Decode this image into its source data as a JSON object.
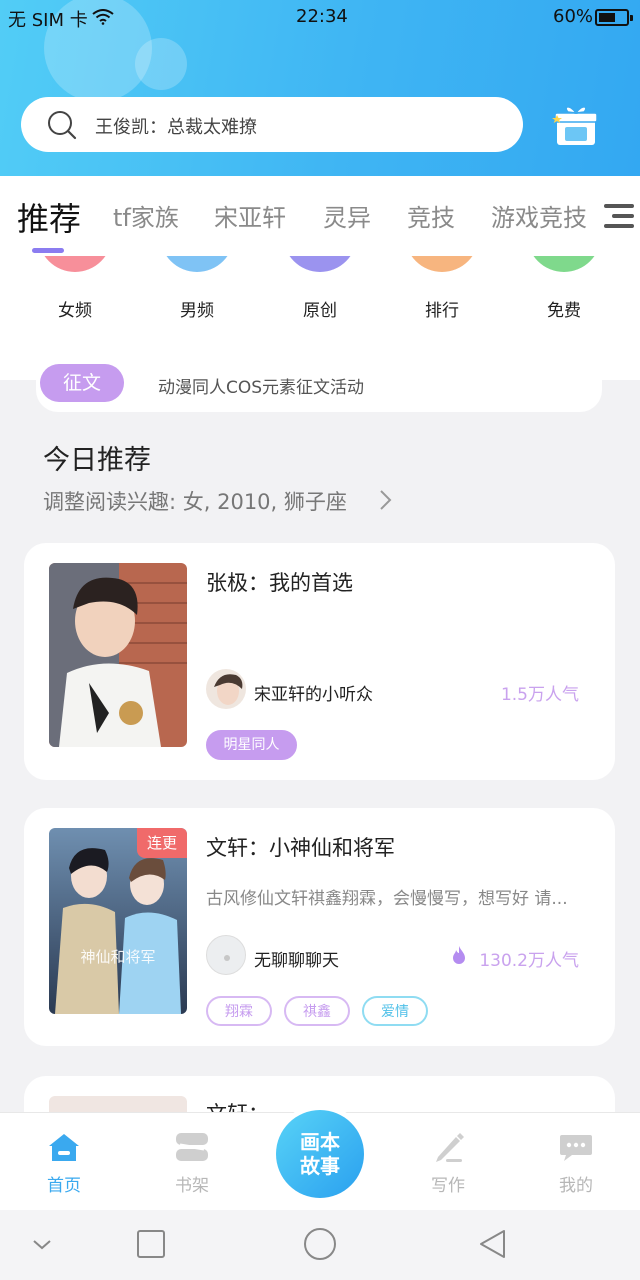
{
  "status_bar": {
    "carrier": "无 SIM 卡",
    "time": "22:34",
    "battery_pct": "60%",
    "battery_level": 0.6
  },
  "search": {
    "query": "王俊凯：总裁太难撩"
  },
  "tabs": [
    {
      "label": "推荐",
      "active": true
    },
    {
      "label": "tf家族"
    },
    {
      "label": "宋亚轩"
    },
    {
      "label": "灵异"
    },
    {
      "label": "竞技"
    },
    {
      "label": "游戏竞技"
    }
  ],
  "categories": [
    {
      "label": "女频",
      "color": "#f78f9a"
    },
    {
      "label": "男频",
      "color": "#7fc3f5"
    },
    {
      "label": "原创",
      "color": "#9b93ef"
    },
    {
      "label": "排行",
      "color": "#f7b57f"
    },
    {
      "label": "免费",
      "color": "#7fd98c"
    }
  ],
  "event": {
    "tag": "征文",
    "text": "动漫同人COS元素征文活动"
  },
  "today": {
    "title": "今日推荐",
    "subtitle": "调整阅读兴趣: 女, 2010, 狮子座"
  },
  "books": [
    {
      "title": "张极：我的首选",
      "author": "宋亚轩的小听众",
      "popularity": "1.5万人气",
      "tags": [
        {
          "label": "明星同人",
          "style": "filled"
        }
      ]
    },
    {
      "title": "文轩：小神仙和将军",
      "badge": "连更",
      "description": "古风修仙文轩祺鑫翔霖，会慢慢写，想写好 请...",
      "author": "无聊聊聊天",
      "popularity": "130.2万人气",
      "tags": [
        {
          "label": "翔霖",
          "style": "outline-purple"
        },
        {
          "label": "祺鑫",
          "style": "outline-purple"
        },
        {
          "label": "爱情",
          "style": "outline-cyan"
        }
      ]
    },
    {
      "title": "文轩："
    }
  ],
  "bottom_nav": {
    "items": [
      {
        "label": "首页",
        "active": true
      },
      {
        "label": "书架"
      },
      {
        "label": "写作"
      },
      {
        "label": "我的"
      }
    ],
    "center_line1": "画本",
    "center_line2": "故事"
  },
  "colors": {
    "accent": "#3aa9ef",
    "purple": "#c69cef",
    "header_start": "#52cdf6",
    "header_end": "#33a8f2"
  }
}
